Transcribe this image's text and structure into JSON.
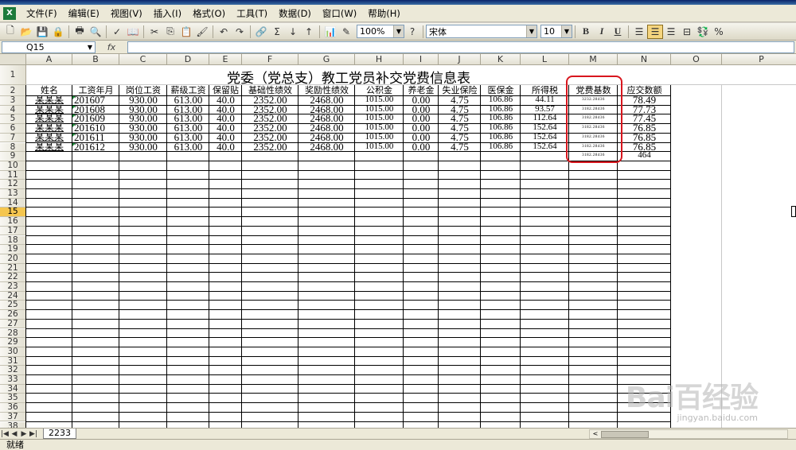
{
  "menu": [
    "文件(F)",
    "编辑(E)",
    "视图(V)",
    "插入(I)",
    "格式(O)",
    "工具(T)",
    "数据(D)",
    "窗口(W)",
    "帮助(H)"
  ],
  "toolbar": {
    "zoom": "100%",
    "font": "宋体",
    "font_size": "10",
    "bold": "B",
    "italic": "I",
    "underline": "U",
    "sigma": "Σ",
    "percent": "%"
  },
  "formula": {
    "cell_ref": "Q15",
    "fx": "fx",
    "value": ""
  },
  "columns": [
    "A",
    "B",
    "C",
    "D",
    "E",
    "F",
    "G",
    "H",
    "I",
    "J",
    "K",
    "L",
    "M",
    "N",
    "O",
    "P"
  ],
  "sheet": {
    "title": "党委（党总支）教工党员补交党费信息表",
    "headers": [
      "姓名",
      "工资年月",
      "岗位工资",
      "薪级工资",
      "保留贴",
      "基础性绩效",
      "奖励性绩效",
      "公积金",
      "养老金",
      "失业保险",
      "医保金",
      "所得税",
      "党费基数",
      "应交数额"
    ],
    "rows": [
      [
        "某某某",
        "201607",
        "930.00",
        "613.00",
        "40.0",
        "2352.00",
        "2468.00",
        "1015.00",
        "0.00",
        "4.75",
        "106.86",
        "44.11",
        "3232.28436",
        "78.49"
      ],
      [
        "某某某",
        "201608",
        "930.00",
        "613.00",
        "40.0",
        "2352.00",
        "2468.00",
        "1015.00",
        "0.00",
        "4.75",
        "106.86",
        "93.57",
        "3182.28436",
        "77.73"
      ],
      [
        "某某某",
        "201609",
        "930.00",
        "613.00",
        "40.0",
        "2352.00",
        "2468.00",
        "1015.00",
        "0.00",
        "4.75",
        "106.86",
        "112.64",
        "3182.28436",
        "77.45"
      ],
      [
        "某某某",
        "201610",
        "930.00",
        "613.00",
        "40.0",
        "2352.00",
        "2468.00",
        "1015.00",
        "0.00",
        "4.75",
        "106.86",
        "152.64",
        "3182.28436",
        "76.85"
      ],
      [
        "某某某",
        "201611",
        "930.00",
        "613.00",
        "40.0",
        "2352.00",
        "2468.00",
        "1015.00",
        "0.00",
        "4.75",
        "106.86",
        "152.64",
        "3182.28436",
        "76.85"
      ],
      [
        "某某某",
        "201612",
        "930.00",
        "613.00",
        "40.0",
        "2352.00",
        "2468.00",
        "1015.00",
        "0.00",
        "4.75",
        "106.86",
        "152.64",
        "3182.28436",
        "76.85"
      ]
    ],
    "row9_m": "3182.28436",
    "row9_n": "464"
  },
  "sheet_tab": "2233",
  "status": "就绪",
  "watermark": {
    "main": "Bai百经验",
    "sub": "jingyan.baidu.com"
  },
  "highlight_color": "#d8161e"
}
